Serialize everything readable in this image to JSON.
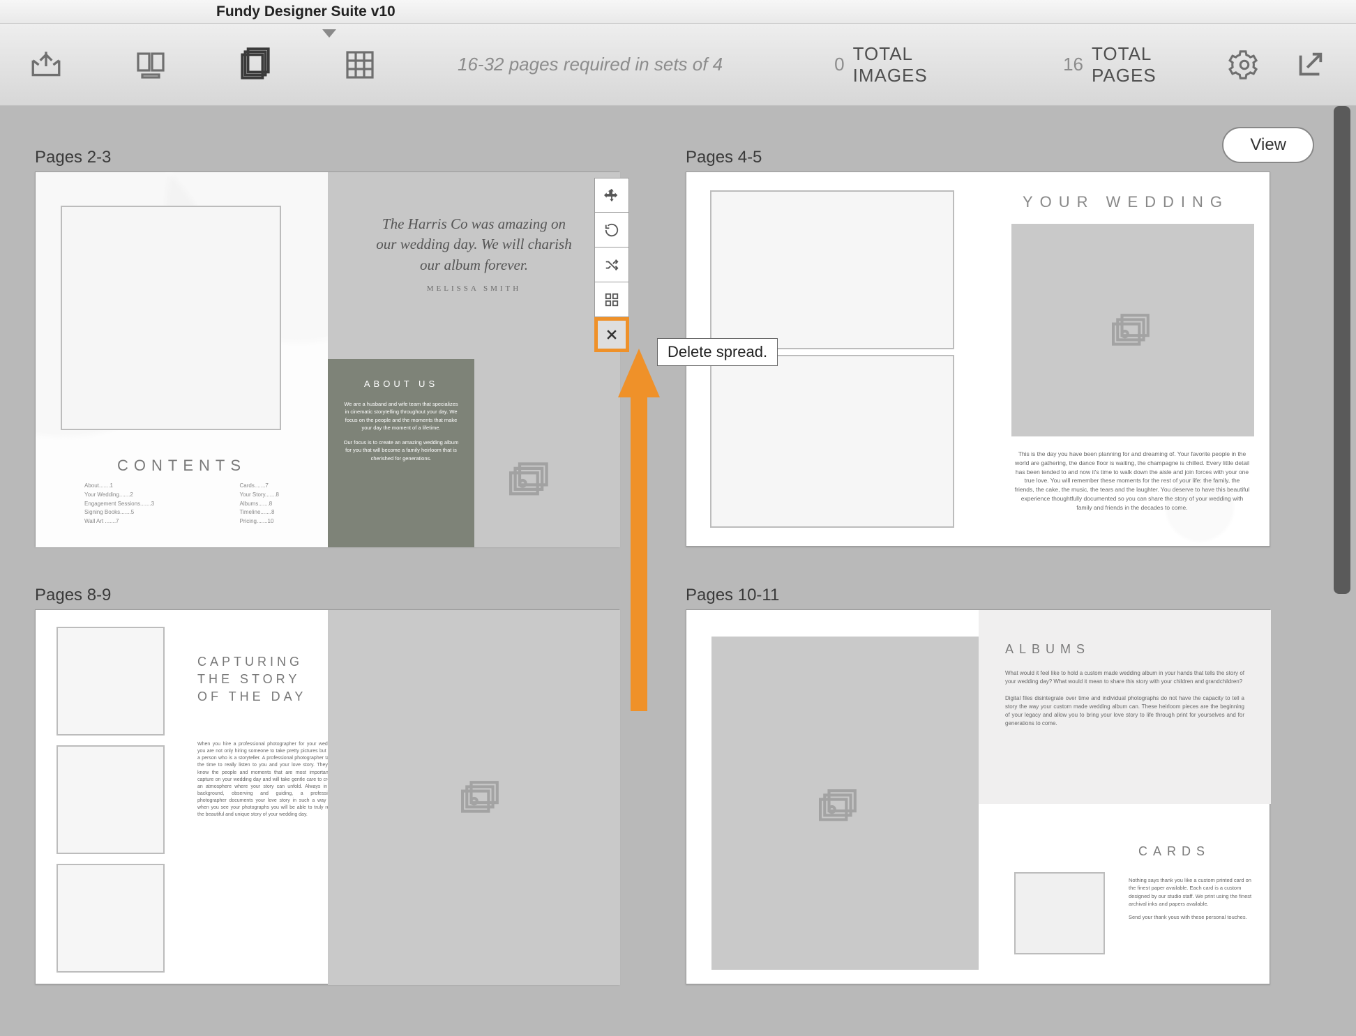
{
  "app": {
    "title": "Fundy Designer Suite v10"
  },
  "toolbar": {
    "info": "16-32 pages required in sets of 4",
    "totalImagesValue": "0",
    "totalImagesLabel": "TOTAL IMAGES",
    "totalPagesValue": "16",
    "totalPagesLabel": "TOTAL PAGES"
  },
  "viewBtn": "View",
  "tooltip": "Delete spread.",
  "spreads": {
    "s23": {
      "label": "Pages 2-3",
      "contentsTitle": "CONTENTS",
      "tocLeft": [
        "About.......1",
        "Your Wedding.......2",
        "Engagement Sessions.......3",
        "Signing Books.......5",
        "Wall Art .......7"
      ],
      "tocRight": [
        "Cards.......7",
        "Your Story.......8",
        "Albums.......8",
        "Timeline.......8",
        "Pricing.......10"
      ],
      "quote": "The Harris Co was amazing on our wedding day. We will charish our album forever.",
      "quoteAuthor": "MELISSA SMITH",
      "aboutTitle": "ABOUT US",
      "aboutText1": "We are a husband and wife team that specializes in cinematic storytelling throughout your day. We focus on the people and the moments that make your day the moment of a lifetime.",
      "aboutText2": "Our focus is to create an amazing wedding album for you that will become a family heirloom that is cherished for generations."
    },
    "s45": {
      "label": "Pages 4-5",
      "title": "YOUR WEDDING",
      "desc": "This is the day you have been planning for and dreaming of. Your favorite people in the world are gathering, the dance floor is waiting, the champagne is chilled. Every little detail has been tended to and now it's time to walk down the aisle and join forces with your one true love. You will remember these moments for the rest of your life: the family, the friends, the cake, the music, the tears and the laughter. You deserve to have this beautiful experience thoughtfully documented so you can share the story of your wedding with family and friends in the decades to come."
    },
    "s89": {
      "label": "Pages 8-9",
      "title": "CAPTURING\nTHE STORY\nOF THE DAY",
      "text": "When you hire a professional photographer for your wedding you are not only hiring someone to take pretty pictures but also a person who is a storyteller. A professional photographer takes the time to really listen to you and your love story. They will know the people and moments that are most important to capture on your wedding day and will take gentle care to create an atmosphere where your story can unfold. Always in the background, observing and guiding, a professional photographer documents your love story in such a way that when you see your photographs you will be able to truly relive the beautiful and unique story of your wedding day."
    },
    "s1011": {
      "label": "Pages 10-11",
      "albumsTitle": "ALBUMS",
      "albumsText1": "What would it feel like to hold a custom made wedding album in your hands that tells the story of your wedding day? What would it mean to share this story with your children and grandchildren?",
      "albumsText2": "Digital files disintegrate over time and individual photographs do not have the capacity to tell a story the way your custom made wedding album can. These heirloom pieces are the beginning of your legacy and allow you to bring your love story to life through print for yourselves and for generations to come.",
      "cardsTitle": "CARDS",
      "cardsText1": "Nothing says thank you like a custom printed card on the finest paper available. Each card is a custom designed by our studio staff. We print using the finest archival inks and papers available.",
      "cardsText2": "Send your thank yous with these personal touches."
    }
  }
}
